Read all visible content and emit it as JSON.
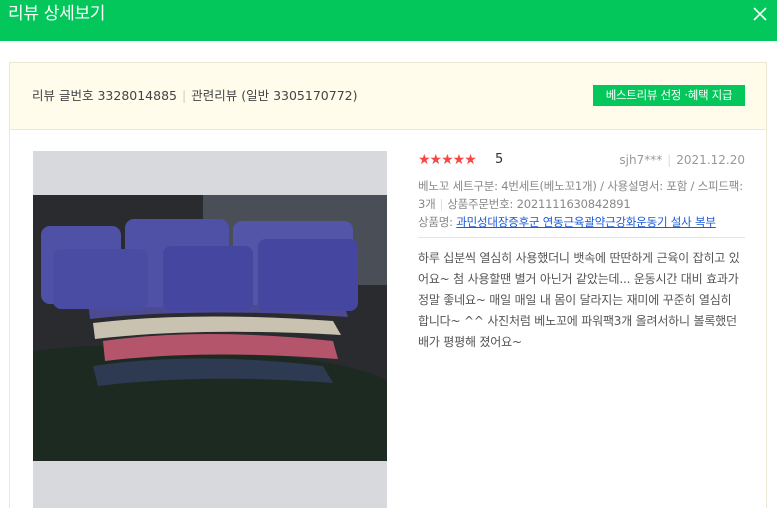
{
  "header": {
    "title": "리뷰 상세보기",
    "close_icon": "close-icon",
    "background": "#03c75a"
  },
  "info_bar": {
    "review_number_label": "리뷰 글번호",
    "review_number": "3328014885",
    "related_label": "관련리뷰",
    "related_value": "(일반 3305170772)",
    "best_badge": "베스트리뷰 선정 ·혜택 지급"
  },
  "review": {
    "stars": "★★★★★",
    "score": "5",
    "author": "sjh7***",
    "date": "2021.12.20",
    "options_line": "베노꼬 세트구분: 4번세트(베노꼬1개) / 사용설명서: 포함 / 스피드팩: 3개",
    "order_label": "상품주문번호:",
    "order_number": "2021111630842891",
    "product_label": "상품명:",
    "product_name": "과민성대장증후군 연동근육괄약근강화운동기 설사 복부",
    "body": "하루 십분씩 열심히 사용했더니 뱃속에 딴딴하게 근육이 잡히고 있어요~ 첨 사용할땐 별거 아닌거 같았는데... 운동시간 대비 효과가 정말 좋네요~ 매일 매일 내 몸이 달라지는 재미에 꾸준히 열심히 합니다~ ^^ 사진처럼 베노꼬에 파워팩3개 올려서하니 볼록했던 배가 평평해 졌어요~"
  }
}
